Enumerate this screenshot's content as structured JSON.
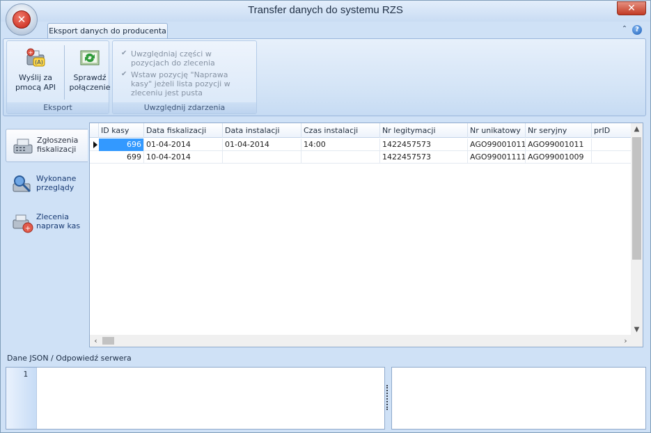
{
  "window": {
    "title": "Transfer danych do systemu RZS",
    "close_label": "✕"
  },
  "ribbon": {
    "tab_label": "Eksport danych do producenta",
    "group_export": {
      "label": "Eksport",
      "send_button": {
        "line1": "Wyślij za",
        "line2": "pmocą API"
      },
      "check_button": {
        "line1": "Sprawdź",
        "line2": "połączenie"
      }
    },
    "group_events": {
      "label": "Uwzględnij zdarzenia",
      "checkbox1": {
        "text": "Uwzględniaj części w pozycjach do zlecenia",
        "checked": true
      },
      "checkbox2": {
        "text": "Wstaw pozycję \"Naprawa kasy\" jeżeli lista pozycji w zleceniu jest pusta",
        "checked": true
      }
    }
  },
  "nav": {
    "items": [
      {
        "line1": "Zgłoszenia",
        "line2": "fiskalizacji",
        "active": true
      },
      {
        "line1": "Wykonane",
        "line2": "przeglądy",
        "active": false
      },
      {
        "line1": "Zlecenia",
        "line2": "napraw kas",
        "active": false
      }
    ]
  },
  "grid": {
    "columns": [
      "ID kasy",
      "Data fiskalizacji",
      "Data instalacji",
      "Czas instalacji",
      "Nr legitymacji",
      "Nr unikatowy",
      "Nr seryjny",
      "prID"
    ],
    "rows": [
      [
        "696",
        "01-04-2014",
        "01-04-2014",
        "14:00",
        "1422457573",
        "AGO99001011",
        "AGO99001011",
        ""
      ],
      [
        "699",
        "10-04-2014",
        "",
        "",
        "1422457573",
        "AGO99001111",
        "AGO99001009",
        ""
      ]
    ]
  },
  "bottom": {
    "caption": "Dane JSON / Odpowiedź serwera",
    "editor_line_number": "1"
  },
  "colors": {
    "selection": "#3399ff",
    "close": "#c23a24"
  }
}
